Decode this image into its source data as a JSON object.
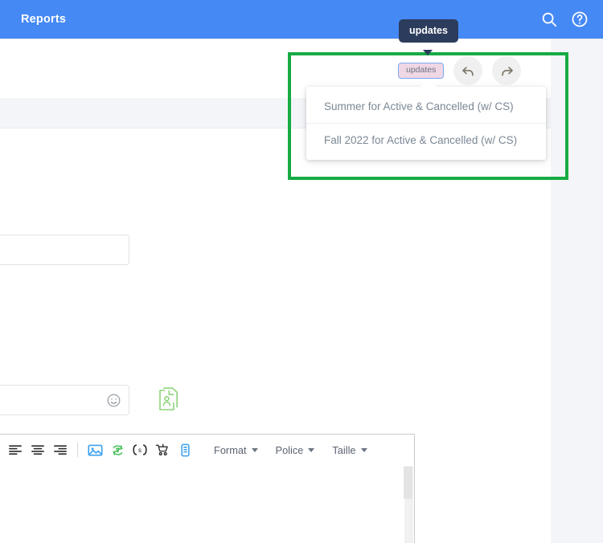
{
  "appbar": {
    "title": "Reports",
    "search_icon": "search-icon",
    "help_icon": "help-circle-icon",
    "background_color": "#4589f5"
  },
  "tooltip": {
    "text": "updates",
    "background_color": "#2c3c5c"
  },
  "highlight": {
    "color": "#17ab44",
    "label": "green-highlight-box"
  },
  "mini_toolbar": {
    "chip_label": "updates",
    "undo_icon": "undo-arrow-icon",
    "redo_icon": "redo-arrow-icon"
  },
  "dropdown": {
    "items": [
      {
        "label": "Summer for Active & Cancelled (w/ CS)"
      },
      {
        "label": "Fall 2022 for Active & Cancelled (w/ CS)"
      }
    ]
  },
  "form": {
    "field_top": {
      "value": "",
      "placeholder": ""
    },
    "field_bottom": {
      "value": "",
      "placeholder": ""
    },
    "emoji_icon": "smiley-face-icon",
    "contact_icon": "contact-card-icon"
  },
  "editor": {
    "toolbar": {
      "align_left_icon": "align-left-icon",
      "align_center_icon": "align-center-icon",
      "align_right_icon": "align-right-icon",
      "image_icon": "insert-image-icon",
      "recycle_icon": "recycle-image-icon",
      "code_icon": "insert-code-icon",
      "cart_icon": "shopping-cart-icon",
      "mobile_icon": "mobile-preview-icon",
      "menus": [
        {
          "label": "Format"
        },
        {
          "label": "Police"
        },
        {
          "label": "Taille"
        }
      ]
    },
    "content": ""
  }
}
